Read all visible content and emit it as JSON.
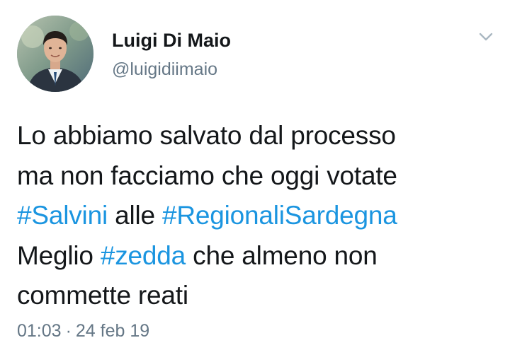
{
  "author": {
    "display_name": "Luigi Di Maio",
    "handle": "@luigidiimaio"
  },
  "menu_icon": "chevron-down-icon",
  "tweet": {
    "line1": "Lo abbiamo salvato dal processo",
    "line2": "ma non facciamo che oggi votate",
    "line3_tag1": "#Salvini",
    "line3_mid": " alle ",
    "line3_tag2": "#RegionaliSardegna",
    "line4_pre": "Meglio ",
    "line4_tag": "#zedda",
    "line4_post": " che almeno non",
    "line5": "commette reati"
  },
  "meta": {
    "time": "01:03",
    "separator": "·",
    "date": "24 feb 19"
  },
  "colors": {
    "hashtag": "#1b95e0",
    "text": "#14171a",
    "secondary": "#657786"
  }
}
